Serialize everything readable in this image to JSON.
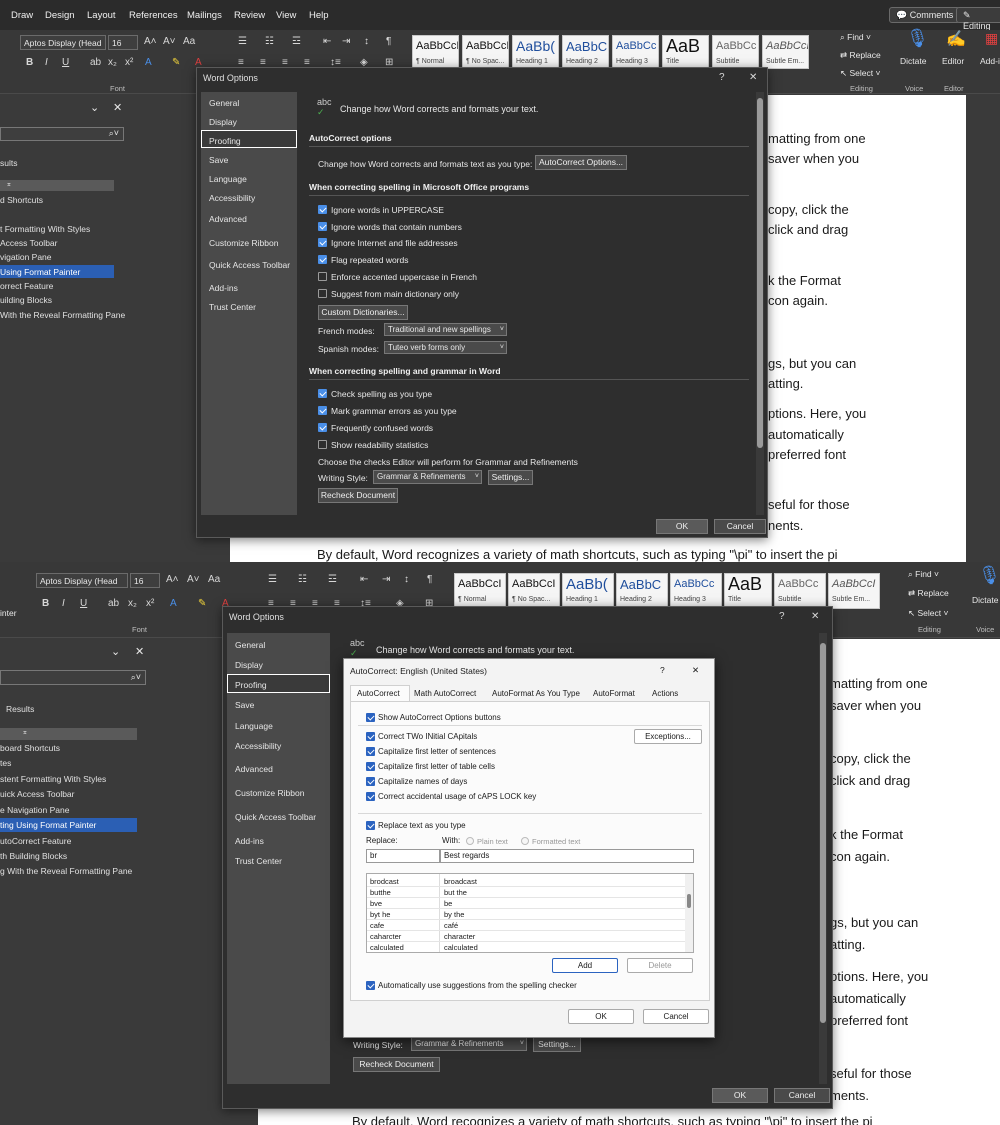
{
  "menu": {
    "items": [
      "Draw",
      "Design",
      "Layout",
      "References",
      "Mailings",
      "Review",
      "View",
      "Help"
    ],
    "comments": "Comments",
    "editing": "Editing"
  },
  "ribbon": {
    "font_name": "Aptos Display (Head",
    "font_size": "16",
    "font_group": "Font",
    "styles": [
      {
        "preview": "AaBbCcI",
        "label": "¶ Normal"
      },
      {
        "preview": "AaBbCcI",
        "label": "¶ No Spac..."
      },
      {
        "preview": "AaBb(",
        "label": "Heading 1"
      },
      {
        "preview": "AaBbC",
        "label": "Heading 2"
      },
      {
        "preview": "AaBbCc",
        "label": "Heading 3"
      },
      {
        "preview": "AaB",
        "label": "Title"
      },
      {
        "preview": "AaBbCc",
        "label": "Subtitle"
      },
      {
        "preview": "AaBbCcI",
        "label": "Subtle Em..."
      }
    ],
    "find": "Find",
    "replace": "Replace",
    "select": "Select",
    "editing_group": "Editing",
    "dictate": "Dictate",
    "voice_group": "Voice",
    "editor": "Editor",
    "editor_group": "Editor",
    "addins": "Add-i",
    "painter_fragment": "inter"
  },
  "nav": {
    "results": "Results",
    "results_short": "sults",
    "items_top": [
      "d Shortcuts",
      "",
      "t Formatting With Styles",
      "Access Toolbar",
      "vigation Pane",
      "Using Format Painter",
      "orrect Feature",
      "uilding Blocks",
      "With the Reveal Formatting Pane"
    ],
    "items_bottom": [
      "board Shortcuts",
      "tes",
      "stent Formatting With Styles",
      "uick Access Toolbar",
      "e Navigation Pane",
      "ting Using Format Painter",
      "utoCorrect Feature",
      "th Building Blocks",
      "g With the Reveal Formatting Pane"
    ]
  },
  "doc": {
    "lines_top": [
      "matting from one",
      "saver when you",
      "copy, click the",
      "click and drag",
      "k the Format",
      "con again.",
      "gs, but you can",
      "atting.",
      "ptions. Here, you",
      "automatically",
      "preferred font",
      "seful for those",
      "nents."
    ],
    "lines_bottom": [
      "matting from one",
      "saver when you",
      "copy, click the",
      "click and drag",
      "k the Format",
      "con again.",
      "gs, but you can",
      "atting.",
      "ptions. Here, you",
      "automatically",
      "preferred font",
      "seful for those",
      "ments."
    ],
    "math_line": "By default, Word recognizes a variety of math shortcuts, such as typing \"\\pi\" to insert the pi",
    "math_line_bottom": "By default, Word recognizes a variety of math shortcuts, such as typing \"\\pi\" to insert the pi"
  },
  "word_options": {
    "title": "Word Options",
    "help": "?",
    "close": "✕",
    "sidebar": [
      "General",
      "Display",
      "Proofing",
      "Save",
      "Language",
      "Accessibility",
      "Advanced",
      "Customize Ribbon",
      "Quick Access Toolbar",
      "Add-ins",
      "Trust Center"
    ],
    "selected": "Proofing",
    "abc": "abc",
    "intro": "Change how Word corrects and formats your text.",
    "autocorrect_heading": "AutoCorrect options",
    "autocorrect_desc": "Change how Word corrects and formats text as you type:",
    "autocorrect_button": "AutoCorrect Options...",
    "spelling_heading": "When correcting spelling in Microsoft Office programs",
    "spelling_options": [
      {
        "label": "Ignore words in UPPERCASE",
        "checked": true
      },
      {
        "label": "Ignore words that contain numbers",
        "checked": true
      },
      {
        "label": "Ignore Internet and file addresses",
        "checked": true
      },
      {
        "label": "Flag repeated words",
        "checked": true
      },
      {
        "label": "Enforce accented uppercase in French",
        "checked": false
      },
      {
        "label": "Suggest from main dictionary only",
        "checked": false
      }
    ],
    "custom_dict": "Custom Dictionaries...",
    "french_label": "French modes:",
    "french_value": "Traditional and new spellings",
    "spanish_label": "Spanish modes:",
    "spanish_value": "Tuteo verb forms only",
    "grammar_heading": "When correcting spelling and grammar in Word",
    "grammar_options": [
      {
        "label": "Check spelling as you type",
        "checked": true
      },
      {
        "label": "Mark grammar errors as you type",
        "checked": true
      },
      {
        "label": "Frequently confused words",
        "checked": true
      },
      {
        "label": "Show readability statistics",
        "checked": false
      }
    ],
    "checks_desc": "Choose the checks Editor will perform for Grammar and Refinements",
    "writing_style_label": "Writing Style:",
    "writing_style_value": "Grammar & Refinements",
    "settings": "Settings...",
    "recheck": "Recheck Document",
    "ok": "OK",
    "cancel": "Cancel"
  },
  "autocorrect": {
    "title": "AutoCorrect: English (United States)",
    "help": "?",
    "close": "✕",
    "tabs": [
      "AutoCorrect",
      "Math AutoCorrect",
      "AutoFormat As You Type",
      "AutoFormat",
      "Actions"
    ],
    "show_buttons": "Show AutoCorrect Options buttons",
    "options": [
      "Correct TWo INitial CApitals",
      "Capitalize first letter of sentences",
      "Capitalize first letter of table cells",
      "Capitalize names of days",
      "Correct accidental usage of cAPS LOCK key"
    ],
    "exceptions": "Exceptions...",
    "replace_text": "Replace text as you type",
    "replace_label": "Replace:",
    "with_label": "With:",
    "plain_text": "Plain text",
    "formatted_text": "Formatted text",
    "replace_value": "br",
    "with_value": "Best regards",
    "entries": [
      [
        "brodcast",
        "broadcast"
      ],
      [
        "butthe",
        "but the"
      ],
      [
        "bve",
        "be"
      ],
      [
        "byt he",
        "by the"
      ],
      [
        "cafe",
        "café"
      ],
      [
        "caharcter",
        "character"
      ],
      [
        "calculated",
        "calculated"
      ]
    ],
    "add": "Add",
    "delete": "Delete",
    "auto_suggest": "Automatically use suggestions from the spelling checker",
    "ok": "OK",
    "cancel": "Cancel"
  }
}
